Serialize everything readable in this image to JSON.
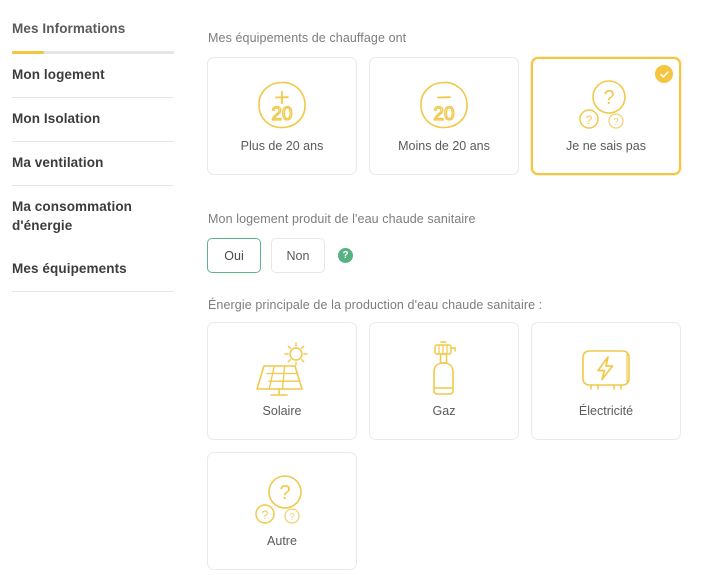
{
  "colors": {
    "accent_yellow": "#f5c542",
    "accent_green": "#56b183",
    "text_dark": "#3c3c3c",
    "text_muted": "#7d7d7d",
    "border_grey": "#eaeaea"
  },
  "sidebar": {
    "items": [
      {
        "label": "Mes Informations",
        "active": true
      },
      {
        "label": "Mon logement",
        "active": false
      },
      {
        "label": "Mon Isolation",
        "active": false
      },
      {
        "label": "Ma ventilation",
        "active": false
      },
      {
        "label": "Ma consommation d'énergie",
        "active": false
      },
      {
        "label": "Mes équipements",
        "active": false
      }
    ]
  },
  "main": {
    "heating_age": {
      "label": "Mes équipements de chauffage ont",
      "options": [
        {
          "label": "Plus de 20 ans",
          "icon": "plus-twenty-icon",
          "selected": false
        },
        {
          "label": "Moins de 20 ans",
          "icon": "minus-twenty-icon",
          "selected": false
        },
        {
          "label": "Je ne sais pas",
          "icon": "question-marks-icon",
          "selected": true
        }
      ]
    },
    "hot_water": {
      "label": "Mon logement produit de l'eau chaude sanitaire",
      "options": [
        {
          "label": "Oui",
          "selected": true
        },
        {
          "label": "Non",
          "selected": false
        }
      ],
      "help_icon": "help-question-icon",
      "help_glyph": "?"
    },
    "energy_source": {
      "label": "Énergie principale de la production d'eau chaude sanitaire :",
      "options": [
        {
          "label": "Solaire",
          "icon": "solar-panel-icon",
          "selected": false
        },
        {
          "label": "Gaz",
          "icon": "gas-bottle-icon",
          "selected": false
        },
        {
          "label": "Électricité",
          "icon": "electric-heater-icon",
          "selected": false
        },
        {
          "label": "Autre",
          "icon": "question-marks-icon",
          "selected": false
        }
      ]
    }
  }
}
